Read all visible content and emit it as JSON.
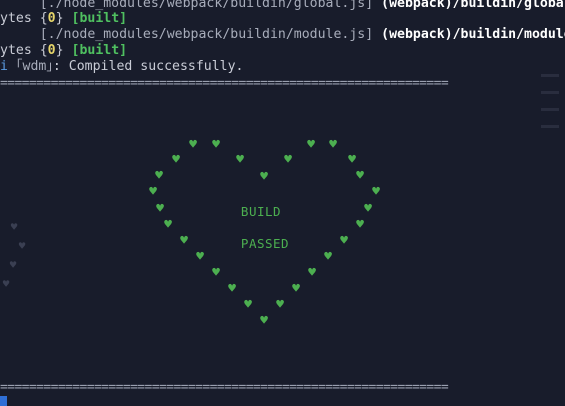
{
  "terminal": {
    "lines": [
      {
        "prefix": "     ",
        "path": "[./node_modules/webpack/buildin/global.js]",
        "tag": "(webpack)/buildin/global."
      },
      {
        "size": "ytes",
        "brace_open": "{",
        "chunk": "0",
        "brace_close": "}",
        "status": "[built]"
      },
      {
        "prefix": "     ",
        "path": "[./node_modules/webpack/buildin/module.js]",
        "tag": "(webpack)/buildin/module"
      },
      {
        "size": "ytes",
        "brace_open": "{",
        "chunk": "0",
        "brace_close": "}",
        "status": "[built]"
      },
      {
        "info": "i",
        "wdm": "｢wdm｣",
        "message": ": Compiled successfully."
      }
    ],
    "separator": "==============================================================",
    "banner": {
      "line1": "BUILD",
      "line2": "PASSED",
      "heart_glyph": "♥"
    }
  },
  "colors": {
    "background": "#181c2b",
    "heart": "#4caf50",
    "chunk": "#e6d56a",
    "built": "#4fc060",
    "info": "#5a9be0"
  }
}
